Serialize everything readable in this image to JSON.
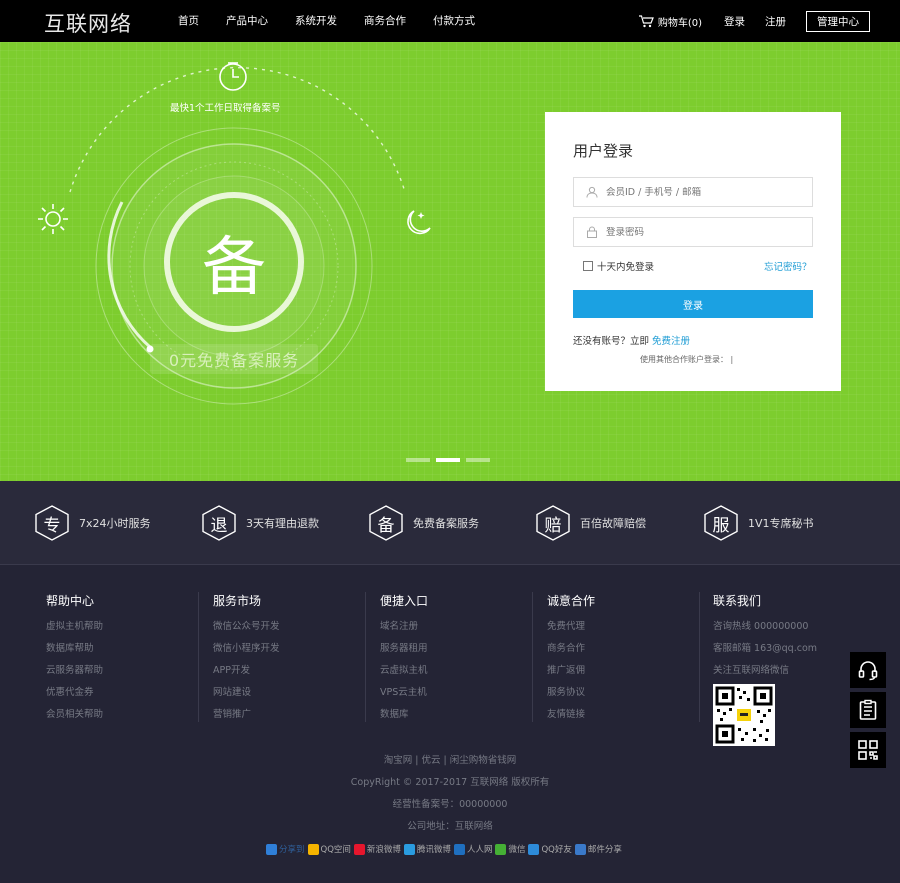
{
  "header": {
    "logo": "互联网络",
    "nav": [
      "首页",
      "产品中心",
      "系统开发",
      "商务合作",
      "付款方式"
    ],
    "cart_label": "购物车(0)",
    "login_label": "登录",
    "register_label": "注册",
    "admin_label": "管理中心"
  },
  "banner": {
    "caption": "最快1个工作日取得备案号",
    "big_char": "备",
    "badge_text": "0元免费备案服务",
    "slides_total": 3,
    "active_slide": 2
  },
  "login": {
    "title": "用户登录",
    "username_placeholder": "会员ID / 手机号 / 邮箱",
    "password_placeholder": "登录密码",
    "remember_label": "十天内免登录",
    "forgot_label": "忘记密码？",
    "submit_label": "登录",
    "no_account_text": "还没有账号？立即",
    "register_link": "免费注册",
    "other_login_text": "使用其他合作账户登录：  |"
  },
  "features": [
    {
      "icon_char": "专",
      "label": "7x24小时服务"
    },
    {
      "icon_char": "退",
      "label": "3天有理由退款"
    },
    {
      "icon_char": "备",
      "label": "免费备案服务"
    },
    {
      "icon_char": "赔",
      "label": "百倍故障赔偿"
    },
    {
      "icon_char": "服",
      "label": "1V1专席秘书"
    }
  ],
  "footer_columns": [
    {
      "title": "帮助中心",
      "links": [
        "虚拟主机帮助",
        "数据库帮助",
        "云服务器帮助",
        "优惠代金券",
        "会员相关帮助"
      ]
    },
    {
      "title": "服务市场",
      "links": [
        "微信公众号开发",
        "微信小程序开发",
        "APP开发",
        "网站建设",
        "营销推广"
      ]
    },
    {
      "title": "便捷入口",
      "links": [
        "域名注册",
        "服务器租用",
        "云虚拟主机",
        "VPS云主机",
        "数据库"
      ]
    },
    {
      "title": "诚意合作",
      "links": [
        "免费代理",
        "商务合作",
        "推广返佣",
        "服务协议",
        "友情链接"
      ]
    },
    {
      "title": "联系我们",
      "links": [
        "咨询热线 000000000",
        "客服邮箱 163@qq.com",
        "关注互联网络微信"
      ]
    }
  ],
  "bottom": {
    "links_line": "淘宝网  |  优云  |  闲尘购物省钱网",
    "copyright": "CopyRight © 2017-2017 互联网络 版权所有",
    "license": "经营性备案号：00000000",
    "address": "公司地址：互联网络"
  },
  "share": [
    {
      "label": "分享到",
      "icon": "plus-icon",
      "color": "#2f7fd8"
    },
    {
      "label": "QQ空间",
      "icon": "qzone-icon",
      "color": "#f5b400"
    },
    {
      "label": "新浪微博",
      "icon": "weibo-icon",
      "color": "#e6162d"
    },
    {
      "label": "腾讯微博",
      "icon": "tencent-weibo-icon",
      "color": "#2a9ce0"
    },
    {
      "label": "人人网",
      "icon": "renren-icon",
      "color": "#1f6fbf"
    },
    {
      "label": "微信",
      "icon": "wechat-icon",
      "color": "#45b035"
    },
    {
      "label": "QQ好友",
      "icon": "qq-icon",
      "color": "#2d8bd9"
    },
    {
      "label": "邮件分享",
      "icon": "mail-icon",
      "color": "#3a79c9"
    }
  ],
  "colors": {
    "banner": "#7dcd2e",
    "primary_button": "#1ba1e2",
    "link": "#1e9cd4",
    "footer_bg": "#242435"
  }
}
